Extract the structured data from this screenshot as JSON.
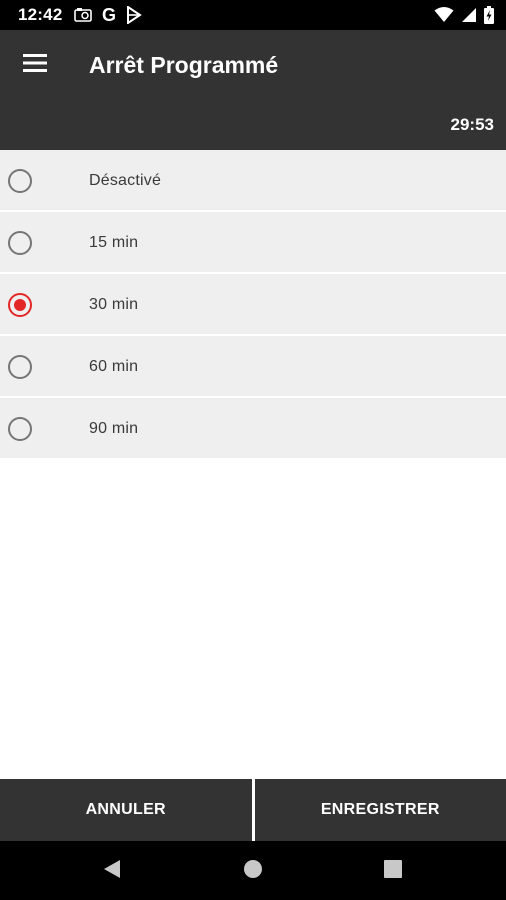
{
  "status_bar": {
    "time": "12:42",
    "left_icons": [
      "photo-sim-icon",
      "google-icon",
      "play-store-icon"
    ],
    "google_letter": "G",
    "right_icons": [
      "wifi-icon",
      "cellular-signal-icon",
      "battery-charging-icon"
    ]
  },
  "app_bar": {
    "title": "Arrêt Programmé",
    "timer": "29:53",
    "menu_icon": "hamburger-menu-icon"
  },
  "options": [
    {
      "label": "Désactivé",
      "selected": false
    },
    {
      "label": "15 min",
      "selected": false
    },
    {
      "label": "30 min",
      "selected": true
    },
    {
      "label": "60 min",
      "selected": false
    },
    {
      "label": "90 min",
      "selected": false
    }
  ],
  "actions": {
    "cancel_label": "ANNULER",
    "save_label": "ENREGISTRER"
  },
  "colors": {
    "app_bar": "#333333",
    "accent": "#e32727",
    "row_background": "#efefef"
  },
  "nav_bar": {
    "icons": [
      "back-icon",
      "home-icon",
      "recents-icon"
    ]
  }
}
